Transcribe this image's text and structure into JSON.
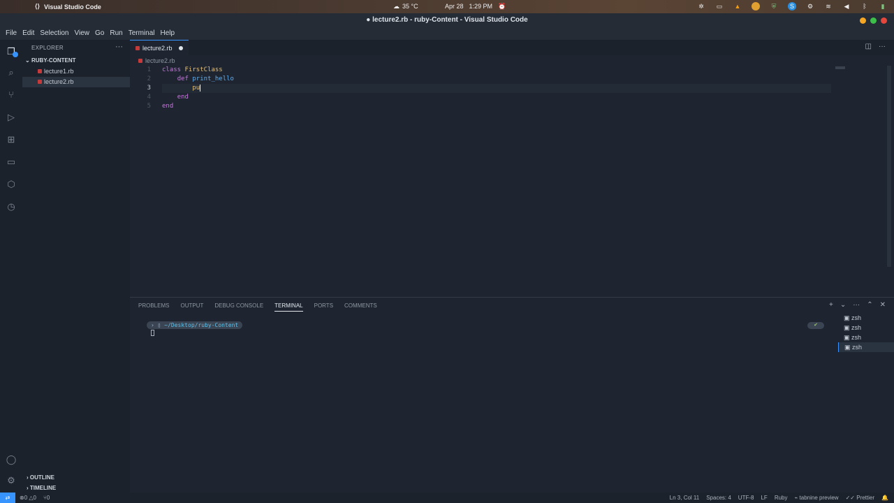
{
  "system": {
    "app_name": "Visual Studio Code",
    "weather": "35 °C",
    "date": "Apr 28",
    "time": "1:29 PM"
  },
  "window": {
    "title": "● lecture2.rb - ruby-Content - Visual Studio Code"
  },
  "menu": [
    "File",
    "Edit",
    "Selection",
    "View",
    "Go",
    "Run",
    "Terminal",
    "Help"
  ],
  "sidebar": {
    "header": "EXPLORER",
    "folder": "RUBY-CONTENT",
    "files": [
      "lecture1.rb",
      "lecture2.rb"
    ],
    "outline": "OUTLINE",
    "timeline": "TIMELINE"
  },
  "editor": {
    "tab_label": "lecture2.rb",
    "breadcrumb": "lecture2.rb",
    "lines": [
      {
        "num": "1",
        "text": "class FirstClass"
      },
      {
        "num": "2",
        "text": "    def print_hello"
      },
      {
        "num": "3",
        "text": "        pu"
      },
      {
        "num": "4",
        "text": "    end"
      },
      {
        "num": "5",
        "text": "end"
      }
    ]
  },
  "panel": {
    "tabs": [
      "PROBLEMS",
      "OUTPUT",
      "DEBUG CONSOLE",
      "TERMINAL",
      "PORTS",
      "COMMENTS"
    ],
    "active_tab": "TERMINAL",
    "prompt_path": "~/Desktop/ruby-Content",
    "terminals": [
      "zsh",
      "zsh",
      "zsh",
      "zsh"
    ]
  },
  "status": {
    "errors": "0",
    "warnings": "0",
    "ports": "0",
    "position": "Ln 3, Col 11",
    "spaces": "Spaces: 4",
    "encoding": "UTF-8",
    "eol": "LF",
    "language": "Ruby",
    "tabnine": "tabnine preview",
    "prettier": "Prettier"
  }
}
